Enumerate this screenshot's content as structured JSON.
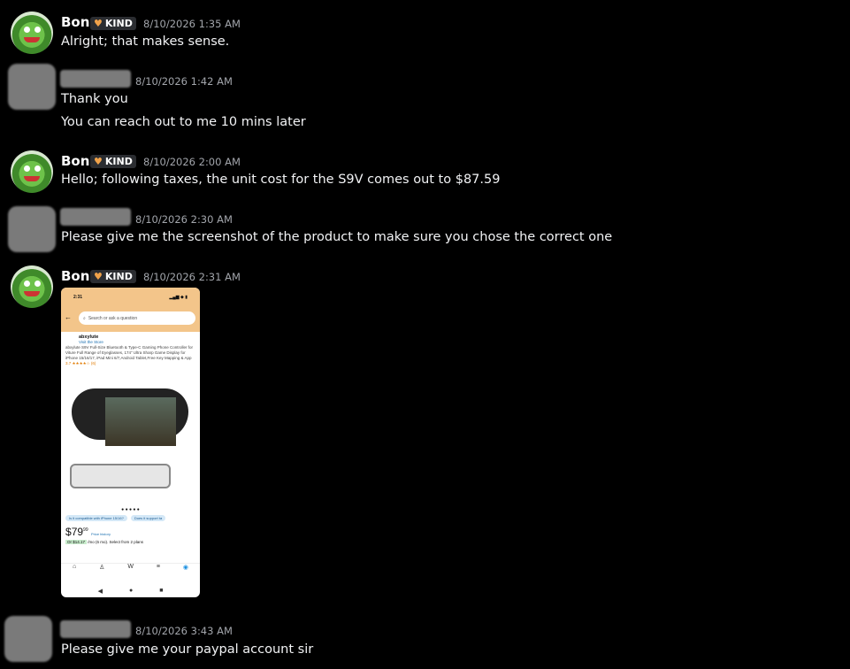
{
  "messages": [
    {
      "author": "Bon",
      "tag": "KIND",
      "timestamp": "8/10/2026 1:35 AM",
      "lines": [
        "Alright; that makes sense."
      ]
    },
    {
      "author": "",
      "timestamp": "8/10/2026 1:42 AM",
      "lines": [
        "Thank you",
        "You can reach out to me 10 mins later"
      ]
    },
    {
      "author": "Bon",
      "tag": "KIND",
      "timestamp": "8/10/2026 2:00 AM",
      "lines": [
        "Hello; following taxes, the unit cost for the S9V comes out to $87.59"
      ]
    },
    {
      "author": "",
      "timestamp": "8/10/2026 2:30 AM",
      "lines": [
        "Please give me the screenshot of the product to make sure you chose the correct one"
      ]
    },
    {
      "author": "Bon",
      "tag": "KIND",
      "timestamp": "8/10/2026 2:31 AM",
      "lines": []
    },
    {
      "author": "",
      "timestamp": "8/10/2026 3:43 AM",
      "lines": [
        "Please give me your paypal account sir"
      ]
    }
  ],
  "attachment": {
    "time": "2:31",
    "search_placeholder": "Search or ask a question",
    "brand": "abxylute",
    "visit": "Visit the Store",
    "title": "abxylute S9V Full-Size Bluetooth & Type-C Gaming Phone Controller for Viture Full Range of Eyeglasses, 174\" Ultra Sharp Game Display for iPhone 15/16/17, iPad Mini 6/7,Android Tablet,Free Key Mapping & App",
    "rating": "3.7 ★★★★☆ (6)",
    "chip1": "Is it compatible with iPhone 15/16?",
    "chip2": "Does it support ta",
    "price": "79",
    "price_cents": "99",
    "price_history": "Price history",
    "monthly_amount": "Or $14.17",
    "monthly_text": "/mo (6 mo). Select from 2 plans"
  }
}
